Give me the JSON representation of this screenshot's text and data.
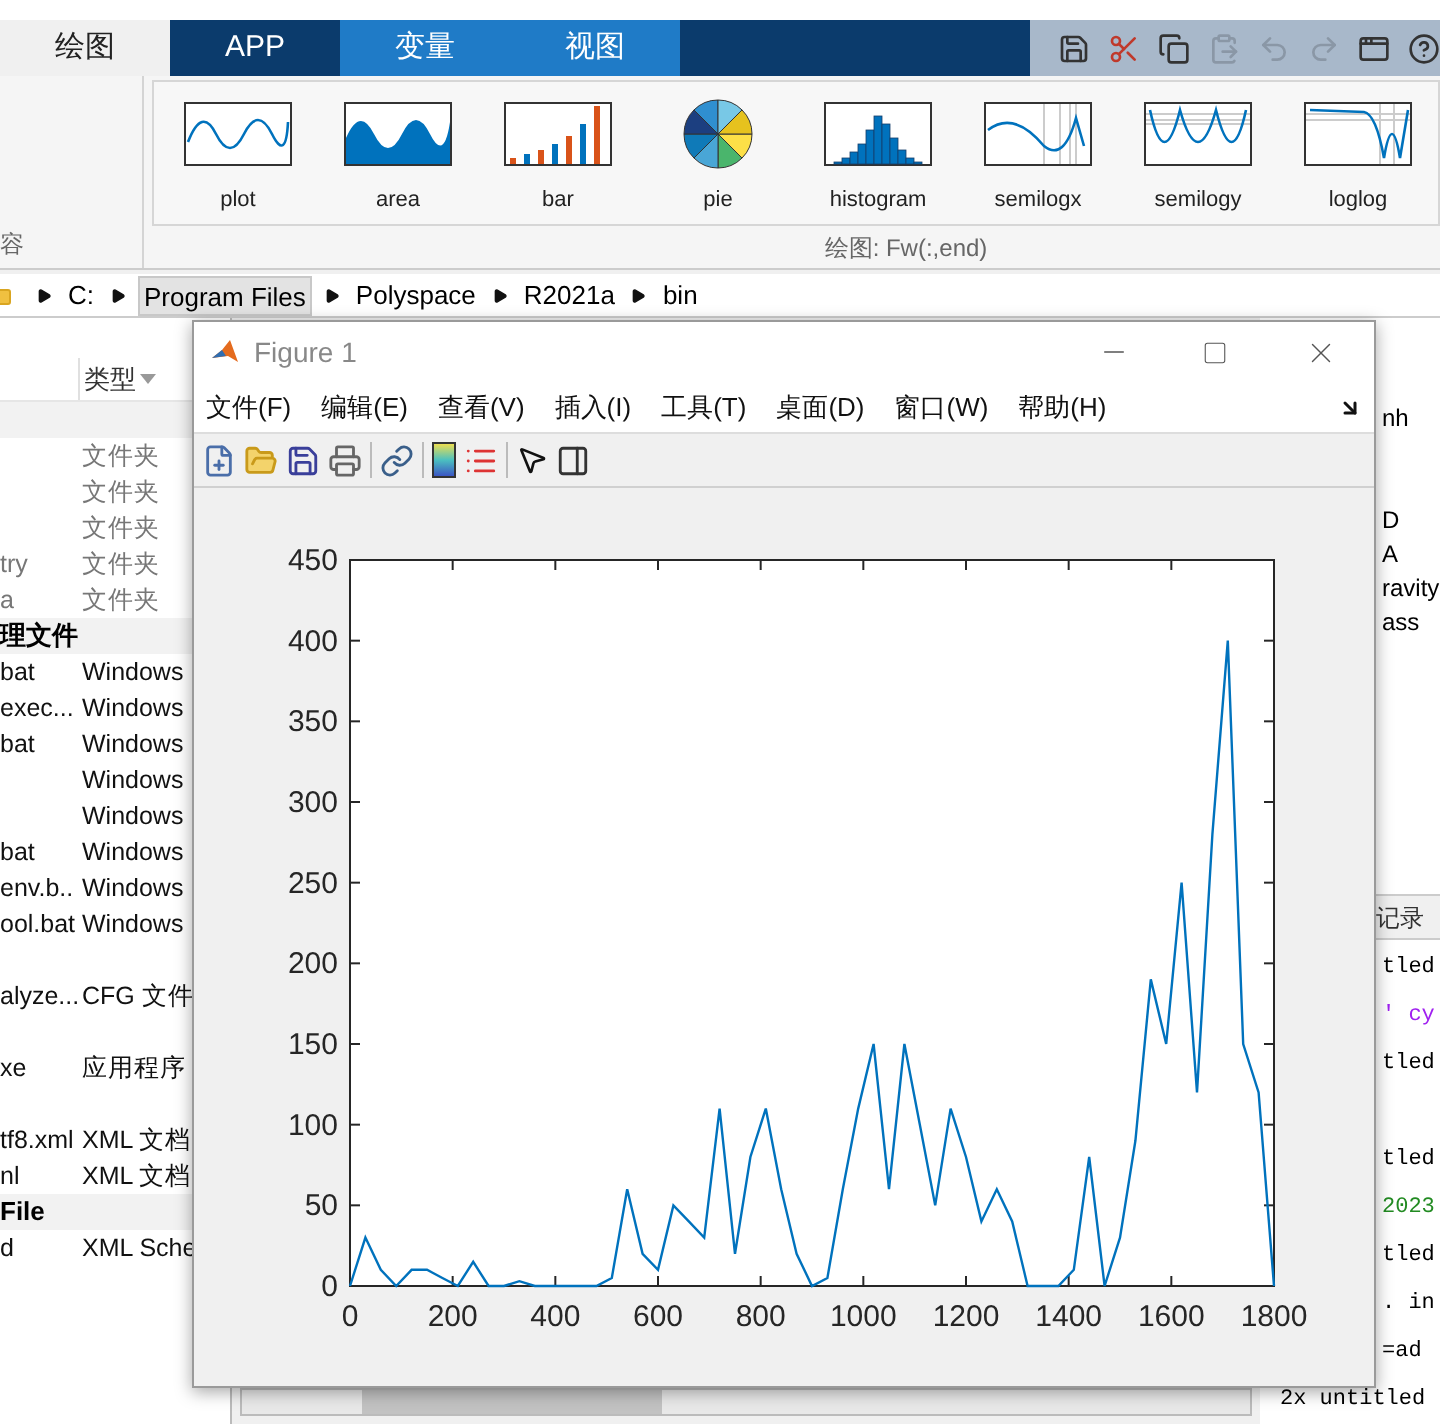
{
  "toolstrip": {
    "tabs": [
      {
        "label": "绘图",
        "selected": true,
        "contextual": false
      },
      {
        "label": "APP",
        "selected": false,
        "contextual": false
      },
      {
        "label": "变量",
        "selected": false,
        "contextual": true
      },
      {
        "label": "视图",
        "selected": false,
        "contextual": true
      }
    ],
    "left_section_label": "容",
    "gallery": [
      {
        "label": "plot",
        "kind": "plot"
      },
      {
        "label": "area",
        "kind": "area"
      },
      {
        "label": "bar",
        "kind": "bar"
      },
      {
        "label": "pie",
        "kind": "pie"
      },
      {
        "label": "histogram",
        "kind": "histogram"
      },
      {
        "label": "semilogx",
        "kind": "semilogx"
      },
      {
        "label": "semilogy",
        "kind": "semilogy"
      },
      {
        "label": "loglog",
        "kind": "loglog"
      }
    ],
    "section_label": "绘图: Fw(:,end)"
  },
  "address_bar": {
    "segments": [
      {
        "label": "C:",
        "selected": false
      },
      {
        "label": "Program Files",
        "selected": true
      },
      {
        "label": "Polyspace",
        "selected": false
      },
      {
        "label": "R2021a",
        "selected": false
      },
      {
        "label": "bin",
        "selected": false
      }
    ]
  },
  "file_browser": {
    "type_header": "类型",
    "rows": [
      {
        "kind": "group"
      },
      {
        "kind": "folder",
        "type": "文件夹"
      },
      {
        "kind": "folder",
        "type": "文件夹"
      },
      {
        "kind": "folder",
        "type": "文件夹"
      },
      {
        "kind": "folder",
        "name": "try",
        "type": "文件夹"
      },
      {
        "kind": "folder",
        "name": "a",
        "type": "文件夹"
      },
      {
        "kind": "group",
        "name": "理文件"
      },
      {
        "kind": "file",
        "name": "bat",
        "type": "Windows"
      },
      {
        "kind": "file",
        "name": "exec...",
        "type": "Windows"
      },
      {
        "kind": "file",
        "name": "bat",
        "type": "Windows"
      },
      {
        "kind": "file",
        "type": "Windows"
      },
      {
        "kind": "file",
        "type": "Windows"
      },
      {
        "kind": "file",
        "name": "bat",
        "type": "Windows"
      },
      {
        "kind": "file",
        "name": "env.b..",
        "type": "Windows"
      },
      {
        "kind": "file",
        "name": "ool.bat",
        "type": "Windows"
      },
      {
        "kind": "blank"
      },
      {
        "kind": "file",
        "name": "alyze...",
        "type": "CFG 文件"
      },
      {
        "kind": "blank"
      },
      {
        "kind": "file",
        "name": "xe",
        "type": "应用程序"
      },
      {
        "kind": "blank"
      },
      {
        "kind": "file",
        "name": "tf8.xml",
        "type": "XML 文档"
      },
      {
        "kind": "file",
        "name": "nl",
        "type": "XML 文档"
      },
      {
        "kind": "group",
        "name": "File"
      },
      {
        "kind": "file",
        "name": "d",
        "type": "XML Sche"
      }
    ]
  },
  "workspace": {
    "items": [
      {
        "kind": "variable",
        "name": "nh"
      },
      {
        "kind": "blank"
      },
      {
        "kind": "blank"
      },
      {
        "kind": "variable",
        "name": "D"
      },
      {
        "kind": "variable",
        "name": "A"
      },
      {
        "kind": "variable",
        "name": "ravity"
      },
      {
        "kind": "variable",
        "name": "ass"
      }
    ]
  },
  "command_history": {
    "title": "记录",
    "lines": [
      {
        "text": "tled",
        "color": "#000000"
      },
      {
        "text": "' cy",
        "color": "#a020f0"
      },
      {
        "text": "tled",
        "color": "#000000"
      },
      {
        "kind": "blank"
      },
      {
        "text": "tled",
        "color": "#000000"
      },
      {
        "text": "2023",
        "color": "#228b22"
      },
      {
        "text": "tled",
        "color": "#000000"
      },
      {
        "text": ". in",
        "color": "#000000"
      },
      {
        "text": "=ad",
        "color": "#000000"
      },
      {
        "text": "2x untitled",
        "color": "#000000"
      }
    ]
  },
  "figure": {
    "title": "Figure 1",
    "menus": [
      "文件(F)",
      "编辑(E)",
      "查看(V)",
      "插入(I)",
      "工具(T)",
      "桌面(D)",
      "窗口(W)",
      "帮助(H)"
    ],
    "chart_data": {
      "type": "line",
      "xlim": [
        0,
        1800
      ],
      "ylim": [
        0,
        450
      ],
      "xticks": [
        0,
        200,
        400,
        600,
        800,
        1000,
        1200,
        1400,
        1600,
        1800
      ],
      "yticks": [
        0,
        50,
        100,
        150,
        200,
        250,
        300,
        350,
        400,
        450
      ],
      "x": [
        0,
        30,
        60,
        90,
        120,
        150,
        180,
        210,
        240,
        270,
        300,
        330,
        360,
        390,
        420,
        450,
        480,
        510,
        540,
        570,
        600,
        630,
        660,
        690,
        720,
        750,
        780,
        810,
        840,
        870,
        900,
        930,
        960,
        990,
        1020,
        1050,
        1080,
        1110,
        1140,
        1170,
        1200,
        1230,
        1260,
        1290,
        1320,
        1350,
        1380,
        1410,
        1440,
        1470,
        1500,
        1530,
        1560,
        1590,
        1620,
        1650,
        1680,
        1710,
        1740,
        1770,
        1800
      ],
      "series": [
        {
          "color": "#0072bd",
          "values": [
            0,
            30,
            10,
            0,
            10,
            10,
            5,
            0,
            15,
            0,
            0,
            3,
            0,
            0,
            0,
            0,
            0,
            5,
            60,
            20,
            10,
            50,
            40,
            30,
            110,
            20,
            80,
            110,
            60,
            20,
            0,
            5,
            60,
            110,
            150,
            60,
            150,
            100,
            50,
            110,
            80,
            40,
            60,
            40,
            0,
            0,
            0,
            10,
            80,
            0,
            30,
            90,
            190,
            150,
            250,
            120,
            280,
            400,
            150,
            120,
            0
          ]
        }
      ]
    }
  }
}
